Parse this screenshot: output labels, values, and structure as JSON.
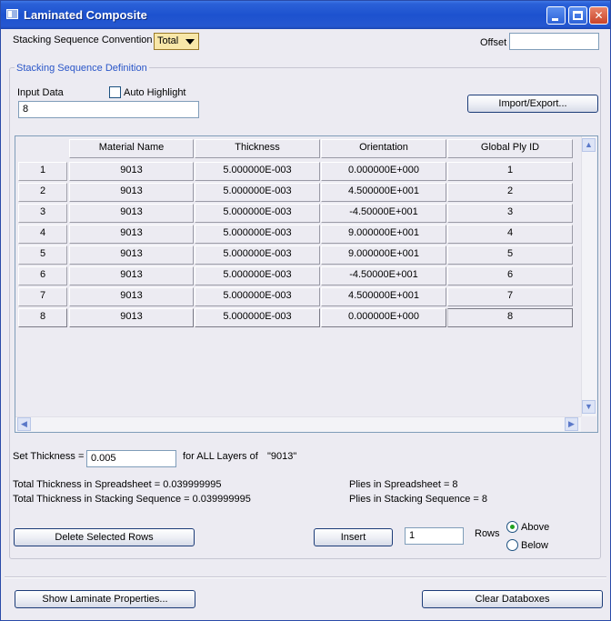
{
  "window": {
    "title": "Laminated Composite"
  },
  "stacking_convention": {
    "label": "Stacking Sequence Convention",
    "value": "Total"
  },
  "offset": {
    "label": "Offset",
    "value": ""
  },
  "definition_group": {
    "title": "Stacking Sequence Definition"
  },
  "input_data": {
    "label": "Input Data",
    "value": "8"
  },
  "auto_highlight": {
    "label": "Auto Highlight",
    "checked": false
  },
  "import_export": {
    "label": "Import/Export..."
  },
  "table": {
    "columns": [
      "Material Name",
      "Thickness",
      "Orientation",
      "Global Ply ID"
    ],
    "rows": [
      {
        "index": "1",
        "material": "9013",
        "thickness": "5.000000E-003",
        "orientation": "0.000000E+000",
        "ply_id": "1"
      },
      {
        "index": "2",
        "material": "9013",
        "thickness": "5.000000E-003",
        "orientation": "4.500000E+001",
        "ply_id": "2"
      },
      {
        "index": "3",
        "material": "9013",
        "thickness": "5.000000E-003",
        "orientation": "-4.50000E+001",
        "ply_id": "3"
      },
      {
        "index": "4",
        "material": "9013",
        "thickness": "5.000000E-003",
        "orientation": "9.000000E+001",
        "ply_id": "4"
      },
      {
        "index": "5",
        "material": "9013",
        "thickness": "5.000000E-003",
        "orientation": "9.000000E+001",
        "ply_id": "5"
      },
      {
        "index": "6",
        "material": "9013",
        "thickness": "5.000000E-003",
        "orientation": "-4.50000E+001",
        "ply_id": "6"
      },
      {
        "index": "7",
        "material": "9013",
        "thickness": "5.000000E-003",
        "orientation": "4.500000E+001",
        "ply_id": "7"
      },
      {
        "index": "8",
        "material": "9013",
        "thickness": "5.000000E-003",
        "orientation": "0.000000E+000",
        "ply_id": "8"
      }
    ]
  },
  "set_thickness": {
    "label": "Set Thickness =",
    "value": "0.005",
    "suffix": "for ALL Layers of",
    "material": "\"9013\""
  },
  "totals": {
    "spreadsheet_thickness": "Total Thickness in Spreadsheet = 0.039999995",
    "stacking_thickness": "Total Thickness in Stacking Sequence = 0.039999995",
    "plies_spreadsheet": "Plies in Spreadsheet = 8",
    "plies_stacking": "Plies in Stacking Sequence = 8"
  },
  "row_ops": {
    "delete_label": "Delete Selected Rows",
    "insert_label": "Insert",
    "count": "1",
    "rows_label": "Rows",
    "above_label": "Above",
    "below_label": "Below",
    "position": "above"
  },
  "footer": {
    "show_properties": "Show Laminate Properties...",
    "clear_databoxes": "Clear Databoxes"
  },
  "colors": {
    "titlebar": "#1d52cf",
    "window_bg": "#ecebf2",
    "group_title": "#2a56c8",
    "combo_bg": "#f8e7a8"
  }
}
